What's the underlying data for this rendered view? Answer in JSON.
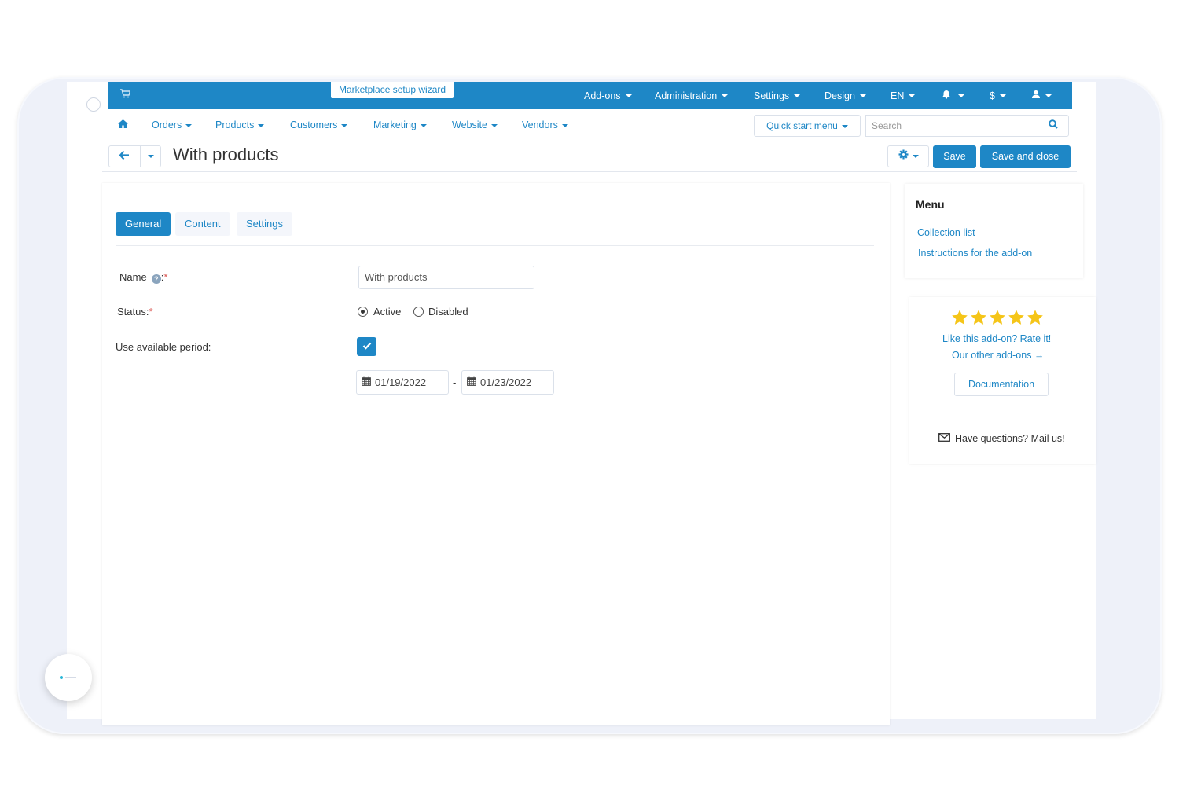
{
  "topbar": {
    "wizard_label": "Marketplace setup wizard",
    "menu": [
      {
        "label": "Add-ons"
      },
      {
        "label": "Administration"
      },
      {
        "label": "Settings"
      },
      {
        "label": "Design"
      },
      {
        "label": "EN"
      },
      {
        "label": "$"
      }
    ],
    "icons": [
      "cart-icon",
      "bell-icon",
      "user-icon"
    ],
    "color": "#1e87c6"
  },
  "nav": {
    "items": [
      {
        "label": "Orders"
      },
      {
        "label": "Products"
      },
      {
        "label": "Customers"
      },
      {
        "label": "Marketing"
      },
      {
        "label": "Website"
      },
      {
        "label": "Vendors"
      }
    ],
    "quick_start": "Quick start menu",
    "search_placeholder": "Search"
  },
  "header": {
    "title": "With products",
    "save": "Save",
    "save_and_close": "Save and close"
  },
  "tabs": [
    {
      "label": "General",
      "active": true
    },
    {
      "label": "Content",
      "active": false
    },
    {
      "label": "Settings",
      "active": false
    }
  ],
  "form": {
    "name_label": "Name",
    "name_suffix": ":",
    "name_value": "With products",
    "status_label": "Status:",
    "status_options": [
      "Active",
      "Disabled"
    ],
    "status_selected": "Active",
    "period_label": "Use available period:",
    "period_checked": true,
    "date_from": "01/19/2022",
    "date_separator": "-",
    "date_to": "01/23/2022",
    "required_mark": "*"
  },
  "sidebar": {
    "menu_title": "Menu",
    "links": [
      "Collection list",
      "Instructions for the add-on"
    ],
    "rating_stars": 5,
    "rate_text": "Like this add-on? Rate it!",
    "other_addons": "Our other add-ons →",
    "documentation": "Documentation",
    "mail_text": "Have questions? Mail us!",
    "star_color": "#f5c518"
  }
}
